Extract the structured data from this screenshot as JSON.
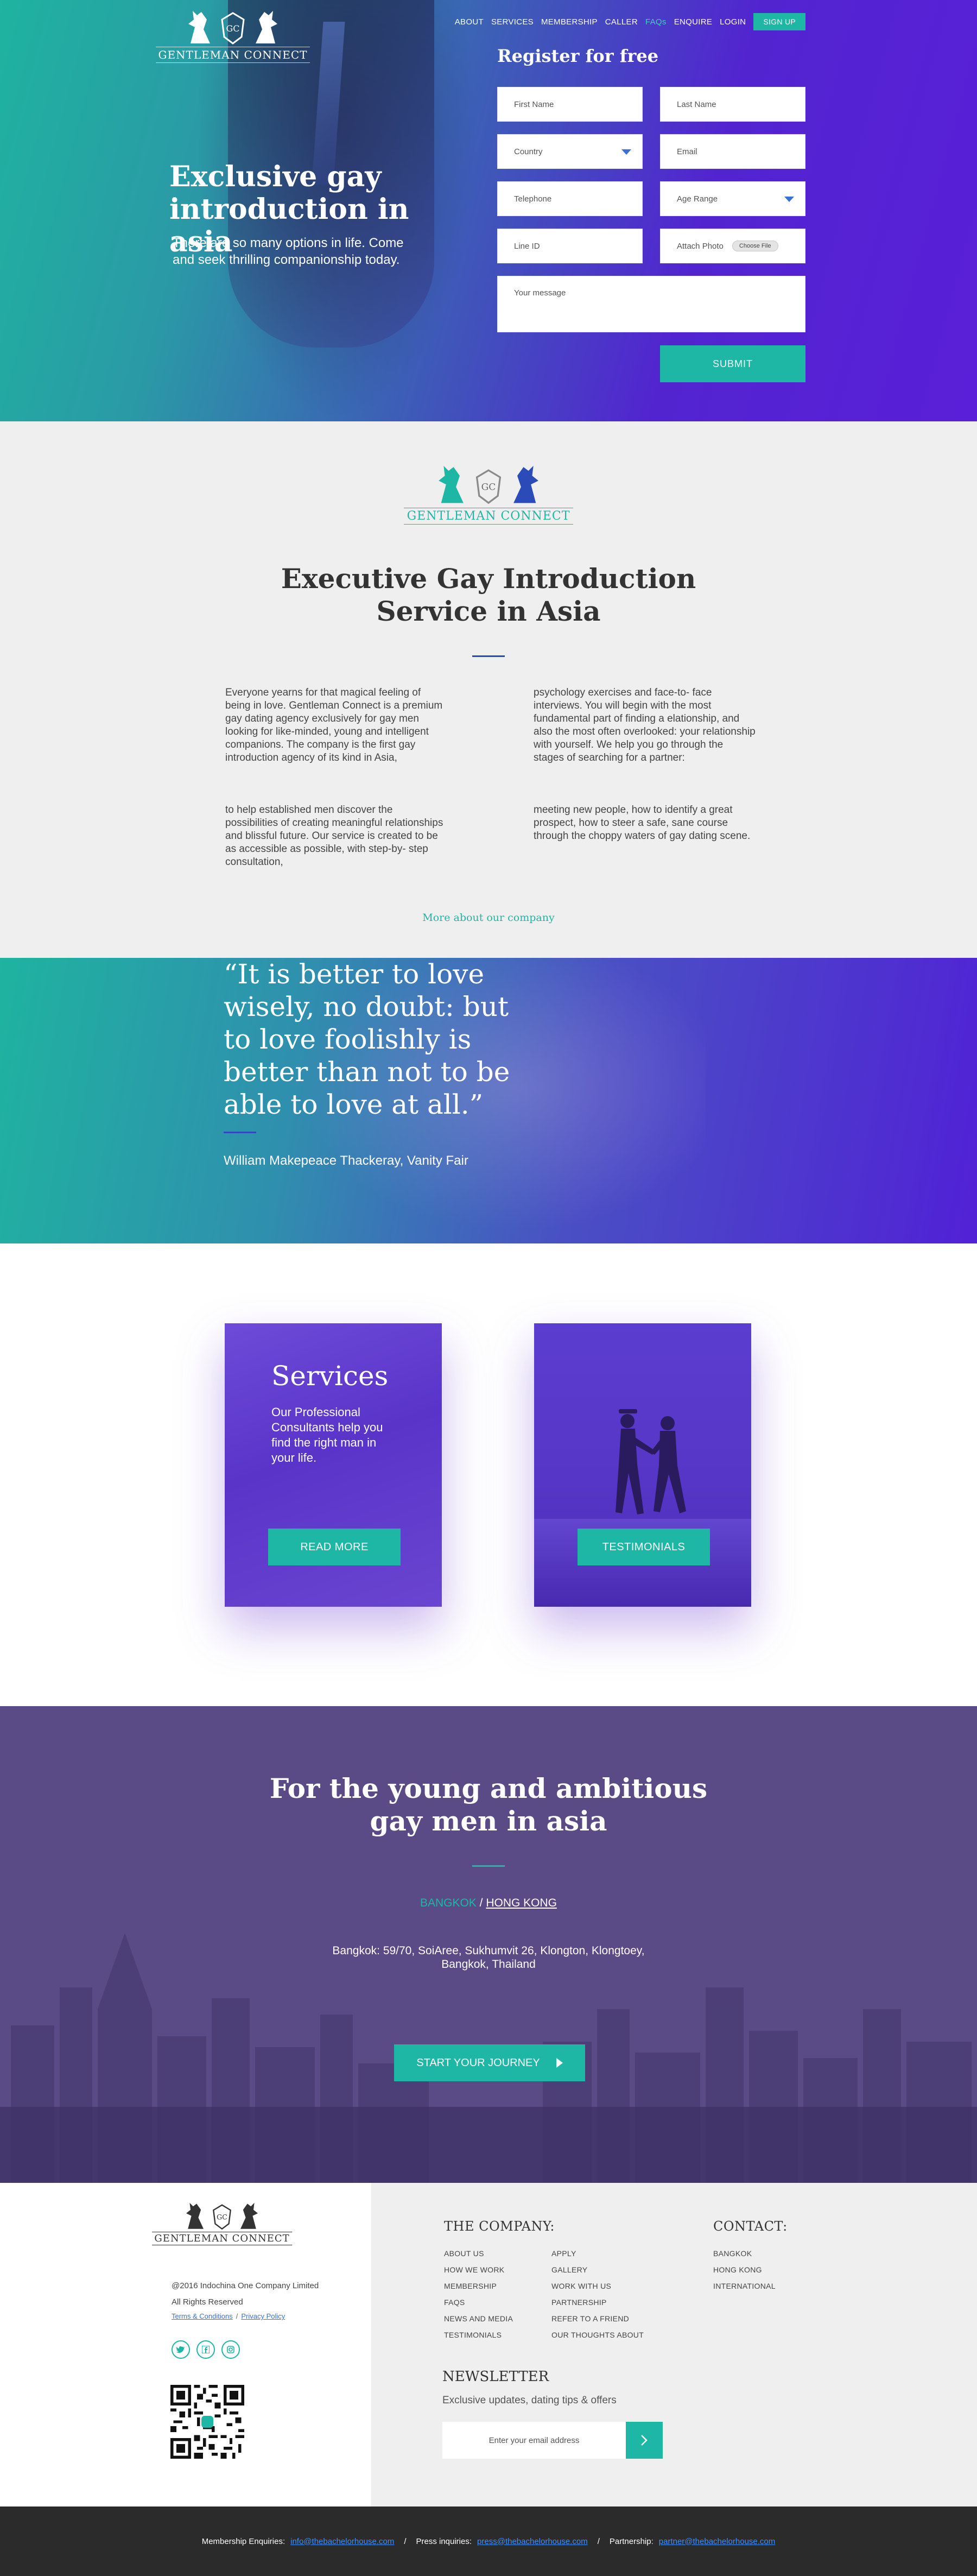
{
  "brand": {
    "name": "GENTLEMAN CONNECT",
    "monogram": "GC"
  },
  "colors": {
    "teal": "#1eb7a5",
    "purple": "#5224d0",
    "dark": "#2b2b2b",
    "link": "#3a6fd8"
  },
  "nav": {
    "items": [
      "ABOUT",
      "SERVICES",
      "MEMBERSHIP",
      "CALLER",
      "FAQs",
      "ENQUIRE",
      "LOGIN"
    ],
    "signup": "SIGN UP"
  },
  "hero": {
    "title": "Exclusive gay introduction in asia",
    "subtitle": "There are so many options in life. Come and seek thrilling companionship today."
  },
  "register": {
    "title": "Register for free",
    "first_name": "First Name",
    "last_name": "Last Name",
    "country": "Country",
    "email": "Email",
    "telephone": "Telephone",
    "age_range": "Age Range",
    "line_id": "Line ID",
    "attach_photo": "Attach Photo",
    "choose_file": "Choose File",
    "message": "Your message",
    "submit": "SUBMIT"
  },
  "about": {
    "title": "Executive Gay Introduction Service in Asia",
    "p1": "Everyone yearns for that magical feeling of being in love. Gentleman Connect is a premium gay dating agency exclusively for gay men looking for like-minded, young and intelligent companions. The company is the first gay introduction agency of its kind in Asia,",
    "p2": "psychology exercises and face-to- face interviews. You will begin with the most fundamental part of finding a elationship, and also the most often overlooked: your relationship with yourself. We help you go through the stages of searching for a partner:",
    "p3": "to help established men discover the possibilities of creating meaningful relationships and blissful future. Our service is created to be as accessible as possible, with step-by- step consultation,",
    "p4": "meeting new people, how to identify a great prospect, how to steer a safe, sane course through the choppy waters of gay dating scene.",
    "more_link": "More about our company"
  },
  "quote": {
    "text": "“It is better to love wisely, no doubt: but to love foolishly is better than not to be able to love at all.”",
    "author": "William Makepeace Thackeray, Vanity Fair"
  },
  "services": {
    "card1": {
      "title": "Services",
      "text": "Our Professional Consultants help you find the right man in your life.",
      "button": "READ MORE"
    },
    "card2": {
      "button": "TESTIMONIALS"
    }
  },
  "ambition": {
    "title": "For the young and ambitious gay men in asia",
    "city1": "BANGKOK",
    "separator": " / ",
    "city2": "HONG KONG",
    "address": "Bangkok: 59/70, SoiAree, Sukhumvit 26, Klongton, Klongtoey, Bangkok, Thailand",
    "button": "START YOUR JOURNEY"
  },
  "footer": {
    "copyright": "@2016 Indochina One Company Limited",
    "rights": "All Rights Reserved",
    "terms": "Terms & Conditions",
    "legal_sep": "/",
    "privacy": "Privacy Policy",
    "social": [
      "twitter-icon",
      "facebook-icon",
      "instagram-icon"
    ],
    "company_title": "THE COMPANY:",
    "company_col1": [
      "ABOUT US",
      "HOW WE WORK",
      "MEMBERSHIP",
      "FAQS",
      "NEWS AND MEDIA",
      "TESTIMONIALS"
    ],
    "company_col2": [
      "APPLY",
      "GALLERY",
      "WORK WITH US",
      "PARTNERSHIP",
      "REFER TO A FRIEND",
      "OUR THOUGHTS ABOUT"
    ],
    "contact_title": "CONTACT:",
    "contact": [
      "BANGKOK",
      "HONG KONG",
      "INTERNATIONAL"
    ],
    "newsletter_title": "NEWSLETTER",
    "newsletter_sub": "Exclusive updates, dating tips & offers",
    "newsletter_placeholder": "Enter your email address"
  },
  "bottom_bar": {
    "membership_label": "Membership Enquiries:",
    "membership_email": "info@thebachelorhouse.com",
    "sep": "/",
    "press_label": "Press inquiries:",
    "press_email": "press@thebachelorhouse.com",
    "partnership_label": "Partnership:",
    "partnership_email": "partner@thebachelorhouse.com"
  }
}
